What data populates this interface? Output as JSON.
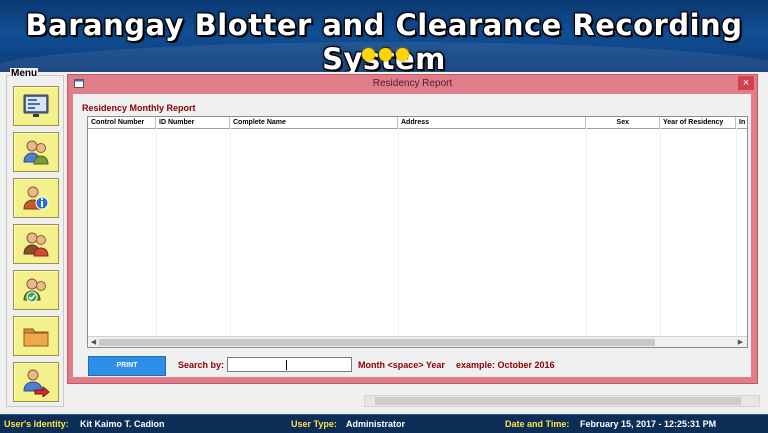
{
  "header": {
    "title": "Barangay Blotter and Clearance Recording System",
    "accent_color": "#ffd400"
  },
  "menu": {
    "title": "Menu",
    "items": [
      {
        "icon": "dashboard-screen-icon"
      },
      {
        "icon": "users-icon"
      },
      {
        "icon": "user-info-icon"
      },
      {
        "icon": "user-edit-icon"
      },
      {
        "icon": "user-check-icon"
      },
      {
        "icon": "folder-icon"
      },
      {
        "icon": "user-logout-icon"
      }
    ]
  },
  "window": {
    "title": "Residency Report",
    "close_label": "×",
    "border_color": "#e07d8b"
  },
  "report": {
    "heading": "Residency Monthly Report",
    "columns": [
      "Control Number",
      "ID Number",
      "Complete Name",
      "Address",
      "Sex",
      "Year of Residency",
      "In"
    ],
    "rows": []
  },
  "controls": {
    "print_label": "PRINT",
    "search_label": "Search by:",
    "search_value": "",
    "format_hint": "Month <space> Year",
    "example_hint": "example:  October 2016"
  },
  "status": {
    "identity_label": "User's Identity:",
    "identity_value": "Kit Kaimo T. Cadion",
    "type_label": "User Type:",
    "type_value": "Administrator",
    "datetime_label": "Date and Time:",
    "datetime_value": "February 15, 2017  -  12:25:31 PM"
  }
}
